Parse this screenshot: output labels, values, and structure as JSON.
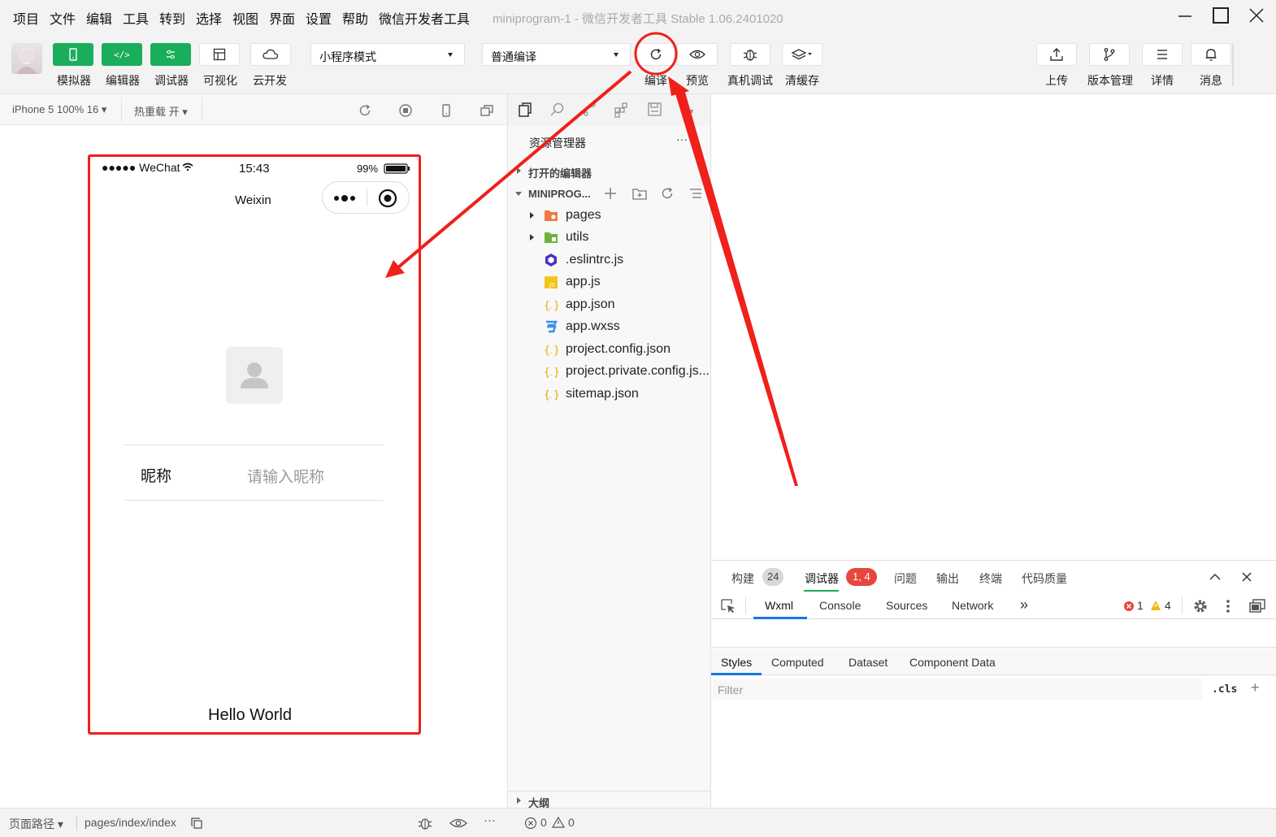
{
  "menu": {
    "items": [
      "项目",
      "文件",
      "编辑",
      "工具",
      "转到",
      "选择",
      "视图",
      "界面",
      "设置",
      "帮助",
      "微信开发者工具"
    ],
    "window_title": "miniprogram-1 - 微信开发者工具 Stable 1.06.2401020"
  },
  "toolbar": {
    "simulator_label": "模拟器",
    "editor_label": "编辑器",
    "debugger_label": "调试器",
    "visual_label": "可视化",
    "cloud_label": "云开发",
    "mode_select": "小程序模式",
    "compile_select": "普通编译",
    "compile_label": "编译",
    "preview_label": "预览",
    "remote_debug_label": "真机调试",
    "clear_cache_label": "清缓存",
    "upload_label": "上传",
    "version_label": "版本管理",
    "details_label": "详情",
    "messages_label": "消息",
    "accent_color": "#1aad5c"
  },
  "simulator": {
    "device": "iPhone 5 100% 16 ▾",
    "hot_reload": "热重载 开 ▾",
    "status_signal": "●●●●● WeChat",
    "status_time": "15:43",
    "status_battery": "99%",
    "nav_title": "Weixin",
    "nickname_label": "昵称",
    "nickname_placeholder": "请输入昵称",
    "footer_text": "Hello World"
  },
  "explorer": {
    "title": "资源管理器",
    "more": "···",
    "open_editors": "打开的编辑器",
    "project": "MINIPROG...",
    "files": [
      {
        "name": "pages",
        "icon": "folder-orange-icon"
      },
      {
        "name": "utils",
        "icon": "folder-green-icon"
      },
      {
        "name": ".eslintrc.js",
        "icon": "eslint-icon"
      },
      {
        "name": "app.js",
        "icon": "js-icon"
      },
      {
        "name": "app.json",
        "icon": "json-icon"
      },
      {
        "name": "app.wxss",
        "icon": "css-icon"
      },
      {
        "name": "project.config.json",
        "icon": "json-icon"
      },
      {
        "name": "project.private.config.js...",
        "icon": "json-icon"
      },
      {
        "name": "sitemap.json",
        "icon": "json-icon"
      }
    ],
    "outline": "大纲"
  },
  "debugger": {
    "tabs": {
      "build": "构建",
      "build_count": "24",
      "debugger": "调试器",
      "debugger_count": "1, 4",
      "issues": "问题",
      "output": "输出",
      "terminal": "终端",
      "code_quality": "代码质量"
    },
    "subtabs": {
      "wxml": "Wxml",
      "console": "Console",
      "sources": "Sources",
      "network": "Network",
      "more": "»"
    },
    "errors": "1",
    "warnings": "4",
    "style_tabs": {
      "styles": "Styles",
      "computed": "Computed",
      "dataset": "Dataset",
      "component_data": "Component Data"
    },
    "filter_placeholder": "Filter",
    "cls": ".cls",
    "plus": "+"
  },
  "statusbar": {
    "page_path_label": "页面路径 ▾",
    "page_path": "pages/index/index",
    "errors": "0",
    "warnings": "0",
    "more": "···"
  }
}
